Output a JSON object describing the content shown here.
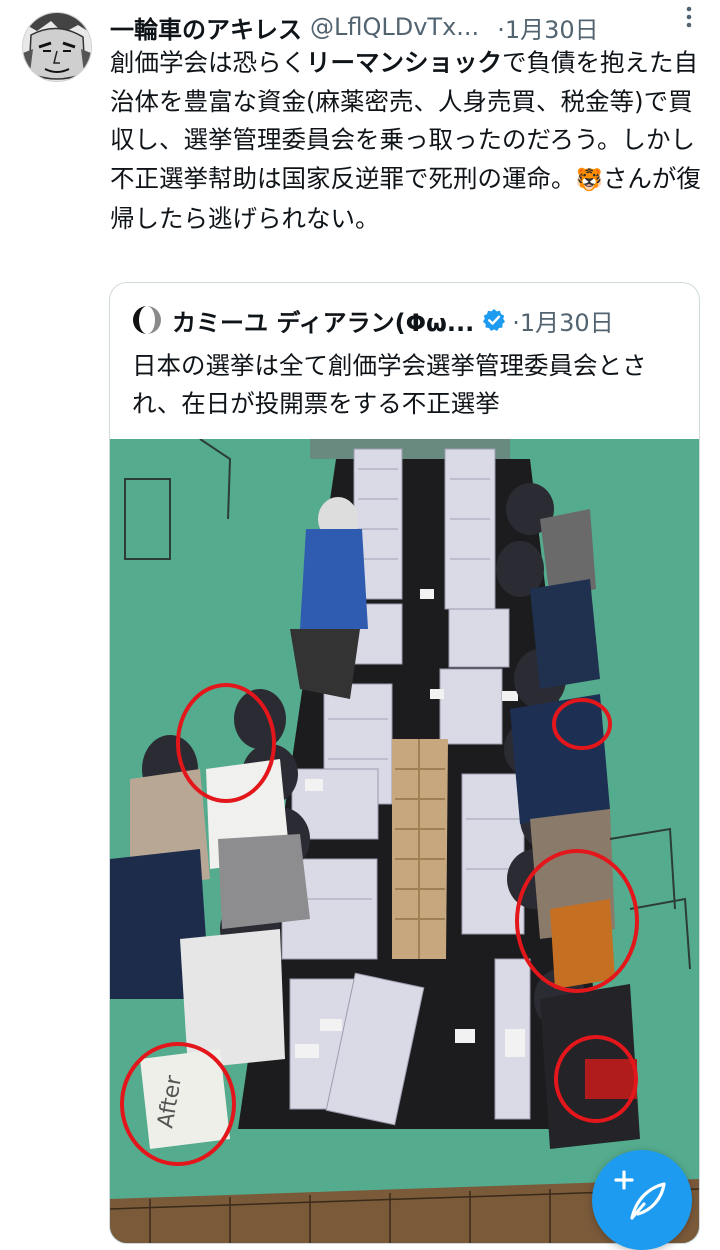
{
  "tweet": {
    "author_name": "一輪車のアキレス",
    "author_handle": "@LflQLDvTx...",
    "date": "·1月30日",
    "text_parts": [
      "創価学会は恐らく",
      "リーマンショック",
      "で負債を抱えた自治体を豊富な資金(麻薬密売、人身売買、税金等)で買収し、選挙管理委員会を乗っ取ったのだろう。しかし不正選挙幇助は国家反逆罪で死刑の運命。",
      "🐯",
      "さんが復帰したら逃げられない。"
    ]
  },
  "quote": {
    "author_name": "カミーユ ディアラン(Φω...",
    "date": "·1月30日",
    "text": "日本の選挙は全て創価学会選挙管理委員会とされ、在日が投開票をする不正選挙",
    "photo_text": "After"
  },
  "compose_button": {
    "icon": "compose-feather-plus-icon"
  },
  "colors": {
    "accent": "#1d9bf0",
    "text": "#0f1419",
    "secondary": "#536471",
    "border": "#cfd9de",
    "circle": "#e3171b"
  }
}
